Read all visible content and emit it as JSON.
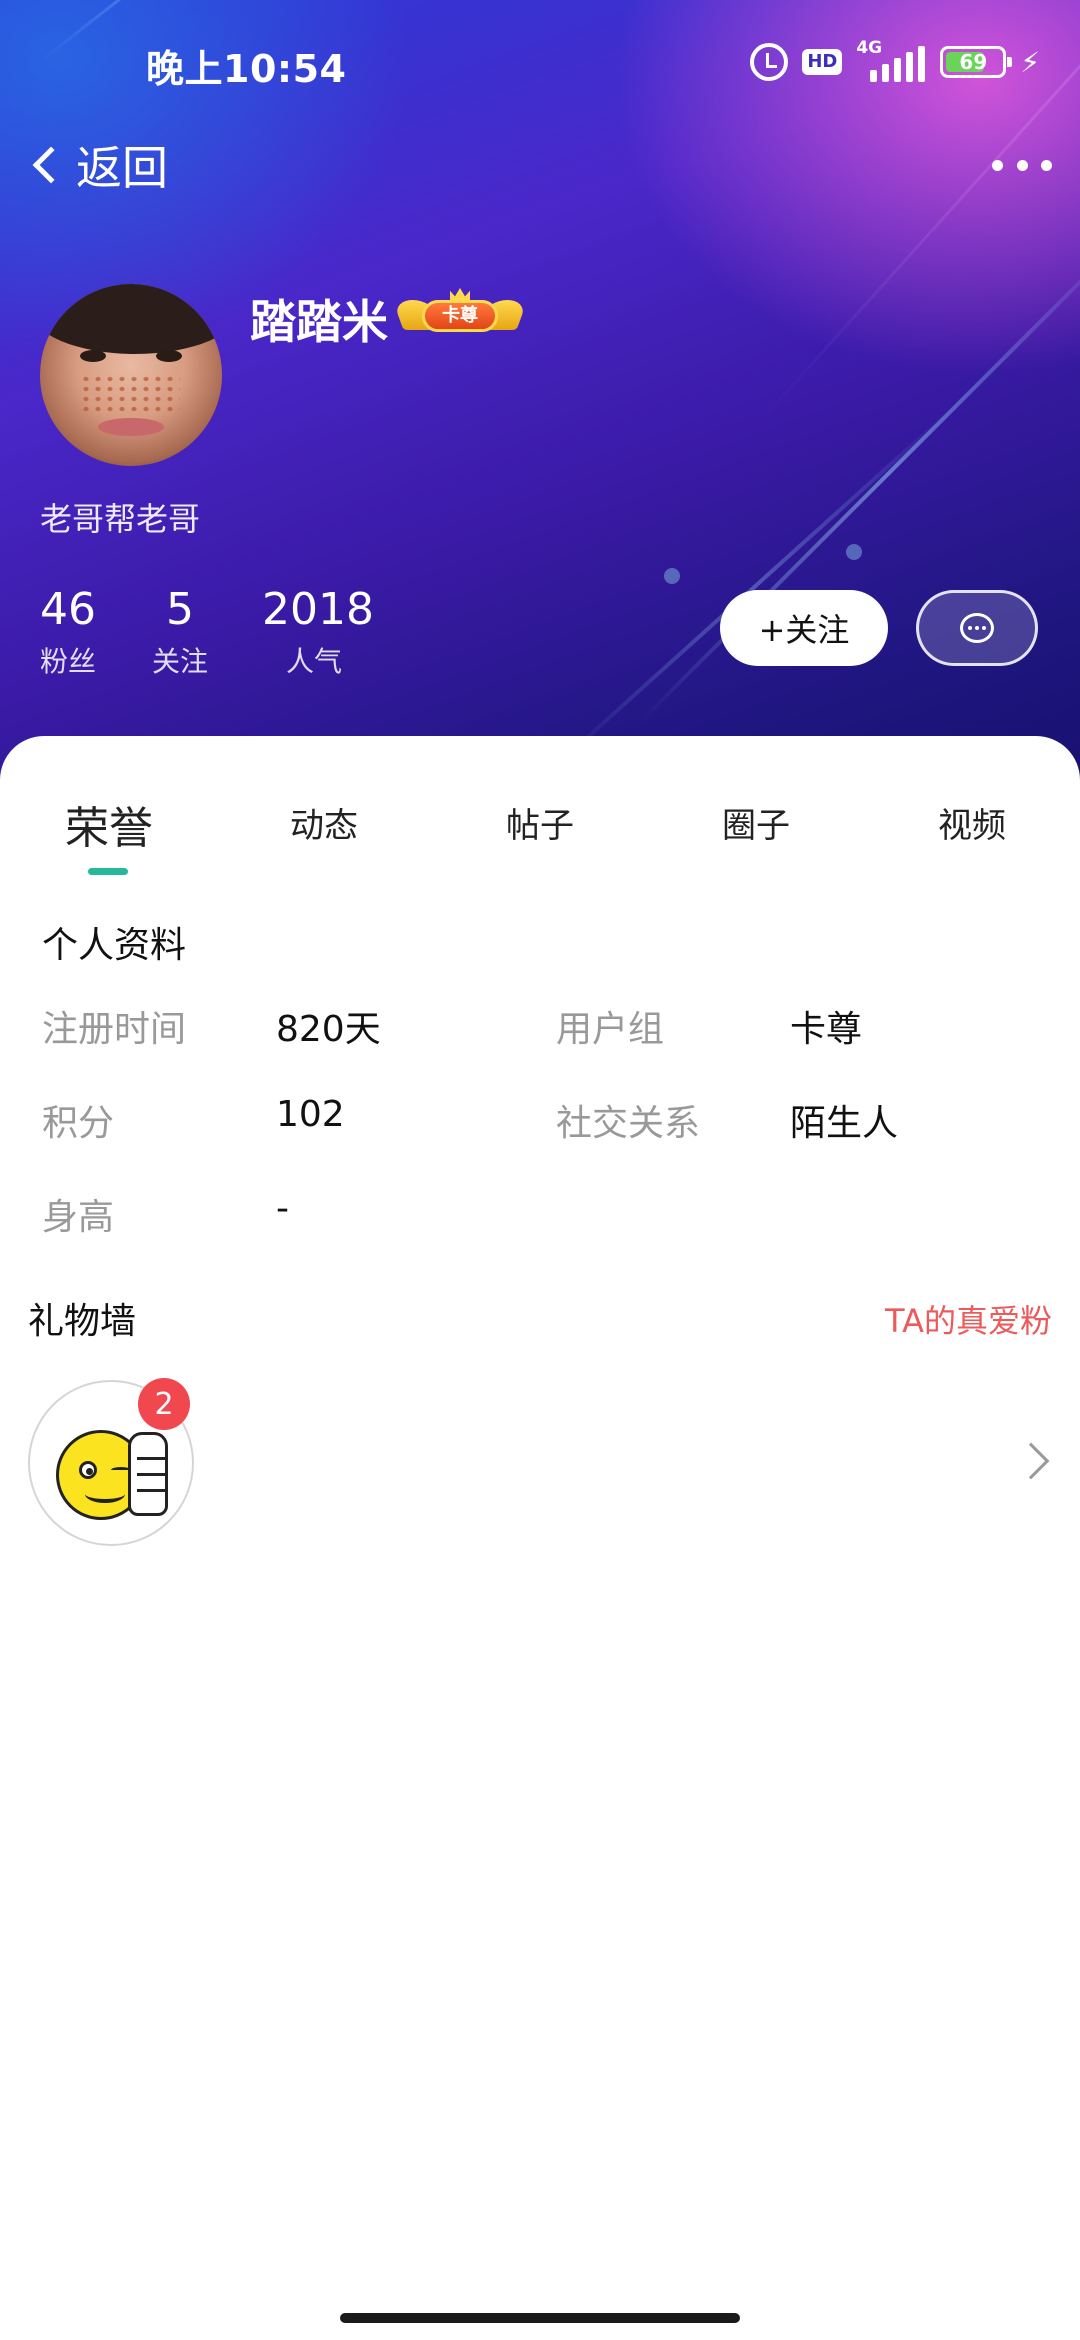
{
  "status_bar": {
    "time": "晚上10:54",
    "hd_label": "HD",
    "network": "4G",
    "battery_level": "69",
    "icons": [
      "alarm-icon",
      "hd-icon",
      "signal-icon",
      "battery-icon",
      "charging-icon"
    ]
  },
  "nav": {
    "back_label": "返回",
    "more_icon": "more-dots-icon"
  },
  "profile": {
    "username": "踏踏米",
    "vip_badge_label": "卡尊",
    "bio": "老哥帮老哥",
    "stats": [
      {
        "value": "46",
        "label": "粉丝"
      },
      {
        "value": "5",
        "label": "关注"
      },
      {
        "value": "2018",
        "label": "人气"
      }
    ],
    "follow_button": "+关注",
    "message_icon": "chat-bubble-icon"
  },
  "tabs": [
    {
      "label": "荣誉",
      "active": true
    },
    {
      "label": "动态",
      "active": false
    },
    {
      "label": "帖子",
      "active": false
    },
    {
      "label": "圈子",
      "active": false
    },
    {
      "label": "视频",
      "active": false
    }
  ],
  "personal_info": {
    "title": "个人资料",
    "fields": [
      {
        "label": "注册时间",
        "value": "820天"
      },
      {
        "label": "用户组",
        "value": "卡尊"
      },
      {
        "label": "积分",
        "value": "102"
      },
      {
        "label": "社交关系",
        "value": "陌生人"
      },
      {
        "label": "身高",
        "value": "-"
      }
    ]
  },
  "gift_wall": {
    "title": "礼物墙",
    "fans_link": "TA的真爱粉",
    "gifts": [
      {
        "icon": "thumbs-up-smiley-icon",
        "count": "2"
      }
    ]
  },
  "colors": {
    "accent_tab": "#26b89a",
    "link_red": "#ec5a5a",
    "badge_red": "#f0484e"
  }
}
